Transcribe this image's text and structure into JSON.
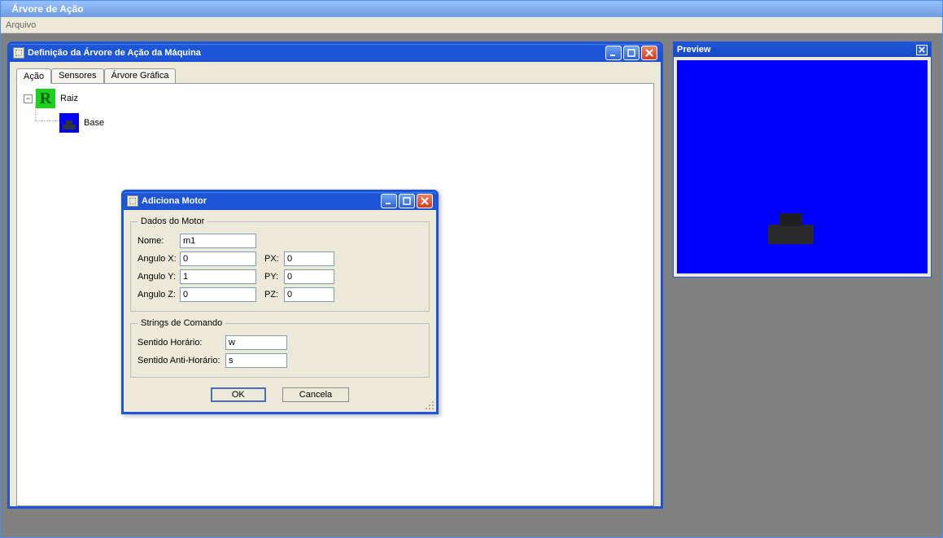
{
  "main": {
    "title": "Árvore de Ação",
    "menu": {
      "arquivo": "Arquivo"
    }
  },
  "def": {
    "title": "Definição da Árvore de Ação da Máquina",
    "tabs": {
      "acao": "Ação",
      "sensores": "Sensores",
      "arvore": "Árvore Gráfica"
    },
    "tree": {
      "root_letter": "R",
      "root_label": "Raiz",
      "base_label": "Base",
      "toggle": "−"
    }
  },
  "motor": {
    "title": "Adiciona Motor",
    "group1": "Dados do Motor",
    "nome_label": "Nome:",
    "nome_value": "m1",
    "ax_label": "Angulo X:",
    "ax_value": "0",
    "px_label": "PX:",
    "px_value": "0",
    "ay_label": "Angulo Y:",
    "ay_value": "1",
    "py_label": "PY:",
    "py_value": "0",
    "az_label": "Angulo Z:",
    "az_value": "0",
    "pz_label": "PZ:",
    "pz_value": "0",
    "group2": "Strings de Comando",
    "sh_label": "Sentido Horário:",
    "sh_value": "w",
    "sah_label": "Sentido Anti-Horário:",
    "sah_value": "s",
    "ok": "OK",
    "cancel": "Cancela"
  },
  "preview": {
    "title": "Preview"
  }
}
